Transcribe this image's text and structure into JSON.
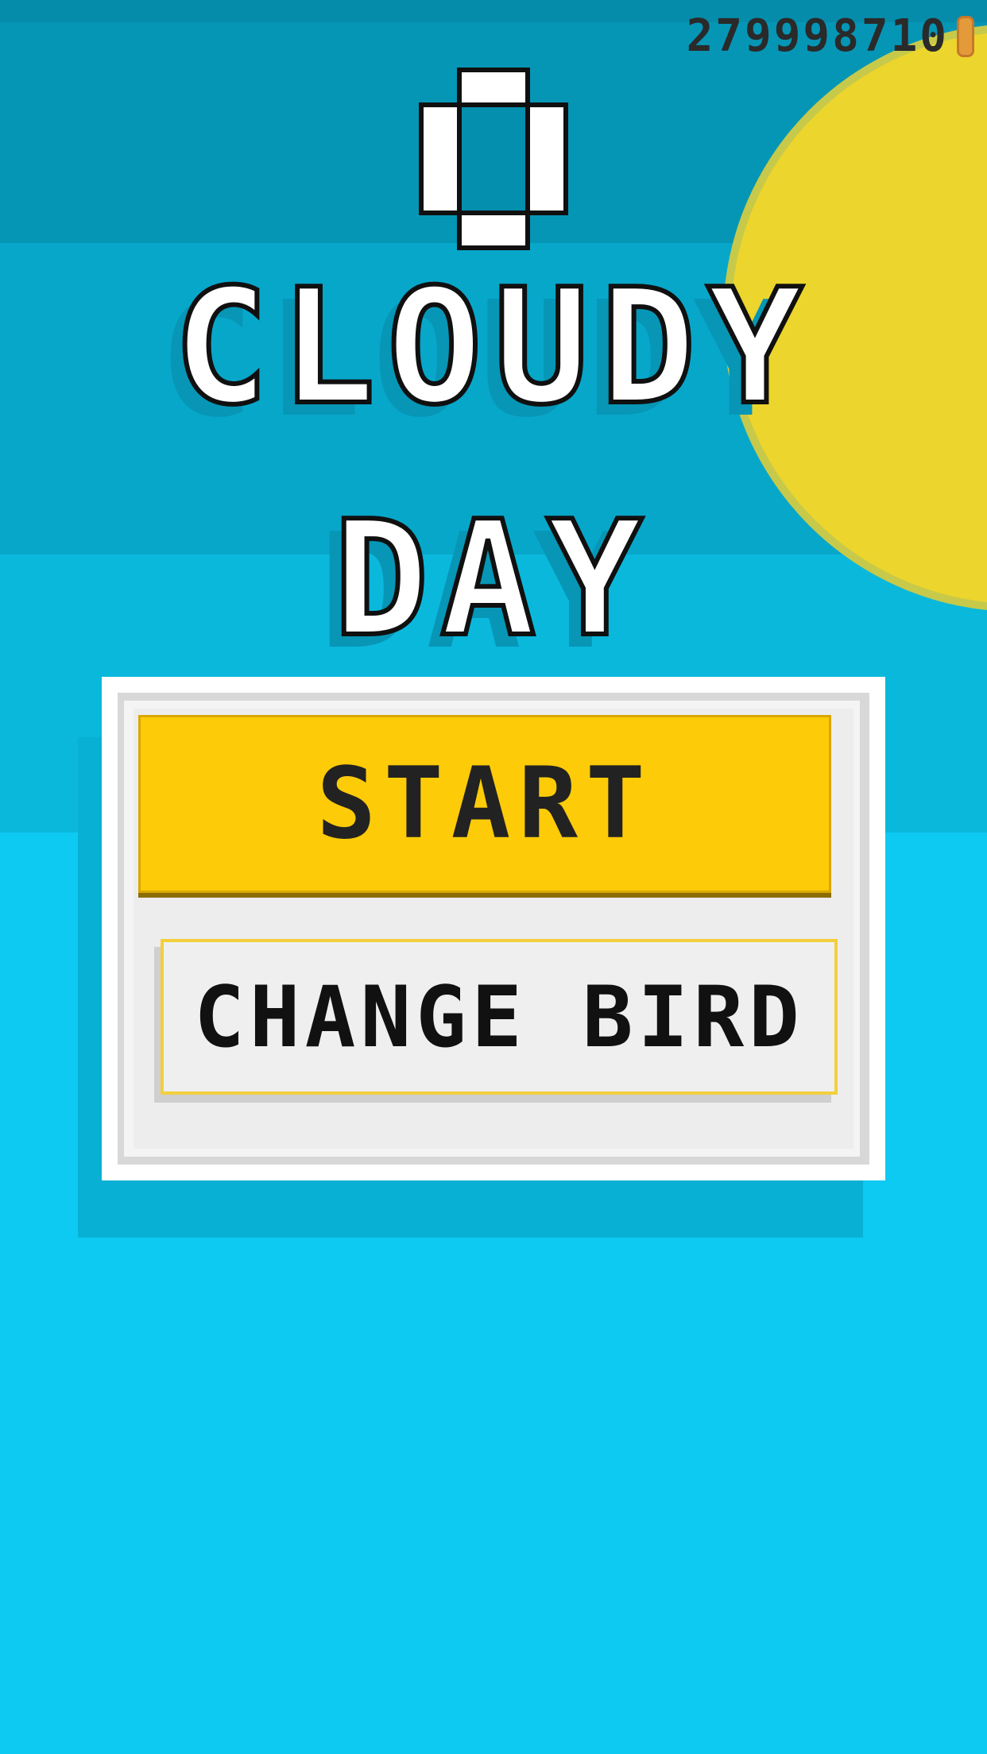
{
  "hud": {
    "coins": "279998710",
    "coin_icon": "coin-icon",
    "score": "0"
  },
  "title": {
    "line1": "CLOUDY",
    "line2": "DAY"
  },
  "menu": {
    "start_label": "START",
    "change_bird_label": "CHANGE BIRD"
  },
  "colors": {
    "sky_dark": "#0596b6",
    "sky_mid": "#07a7ca",
    "sky_light": "#0dcaf2",
    "sun": "#ecd52c",
    "start_button": "#fecb08",
    "panel": "#ededed"
  }
}
